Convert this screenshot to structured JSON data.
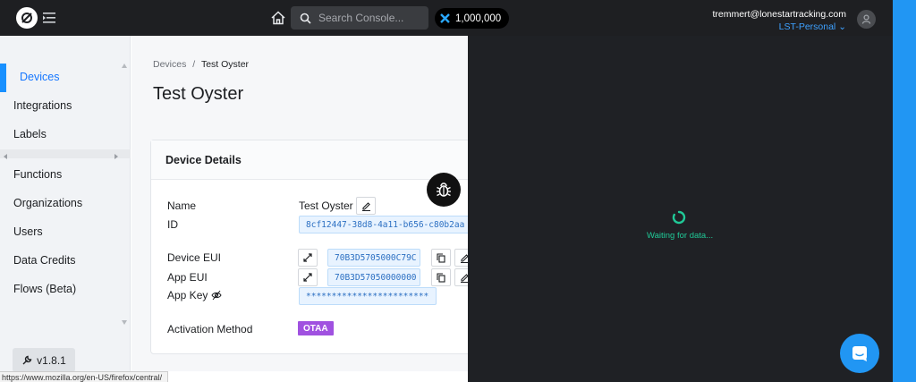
{
  "topbar": {
    "search_placeholder": "Search Console...",
    "credits": "1,000,000",
    "account_email": "tremmert@lonestartracking.com",
    "account_org": "LST-Personal",
    "org_chevron": "⌄"
  },
  "sidebar": {
    "items": [
      {
        "label": "Devices"
      },
      {
        "label": "Integrations"
      },
      {
        "label": "Labels"
      },
      {
        "label": "Functions"
      },
      {
        "label": "Organizations"
      },
      {
        "label": "Users"
      },
      {
        "label": "Data Credits"
      },
      {
        "label": "Flows (Beta)"
      }
    ],
    "version": "v1.8.1"
  },
  "breadcrumb": {
    "root": "Devices",
    "sep": "/",
    "current": "Test Oyster"
  },
  "page": {
    "title": "Test Oyster"
  },
  "device_details": {
    "heading": "Device Details",
    "name_label": "Name",
    "name_value": "Test Oyster",
    "id_label": "ID",
    "id_value": "8cf12447-38d8-4a11-b656-c80b2aa",
    "dev_eui_label": "Device EUI",
    "dev_eui_value": "70B3D5705000C79C",
    "app_eui_label": "App EUI",
    "app_eui_value": "70B3D57050000000",
    "app_key_label": "App Key",
    "app_key_value": "************************",
    "activation_label": "Activation Method",
    "activation_value": "OTAA"
  },
  "debug_panel": {
    "status": "Waiting for data..."
  },
  "status_bar": {
    "url": "https://www.mozilla.org/en-US/firefox/central/"
  },
  "colors": {
    "topbar_bg": "#1e1f22",
    "accent": "#1890ff",
    "otaa_badge": "#a051e0",
    "waiting_text": "#20c997"
  }
}
